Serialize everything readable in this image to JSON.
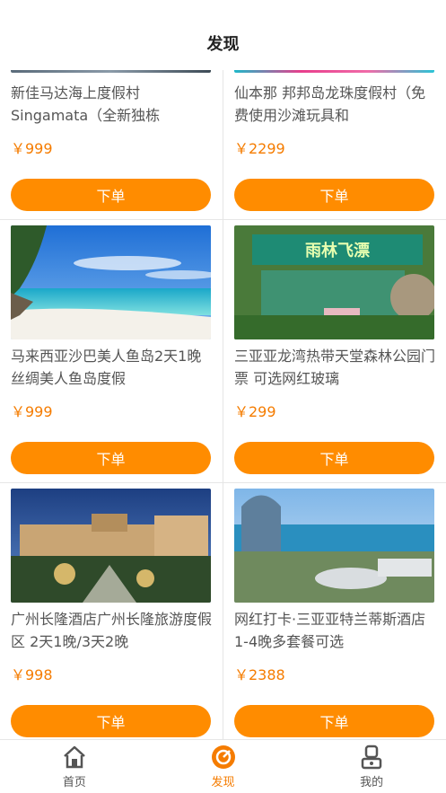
{
  "header": {
    "title": "发现"
  },
  "products": [
    {
      "name": "新佳马达海上度假村 Singamata（全新独栋",
      "price": "￥999",
      "button": "下单"
    },
    {
      "name": "仙本那 邦邦岛龙珠度假村（免费使用沙滩玩具和",
      "price": "￥2299",
      "button": "下单"
    },
    {
      "name": "马来西亚沙巴美人鱼岛2天1晚 丝绸美人鱼岛度假",
      "price": "￥999",
      "button": "下单"
    },
    {
      "name": "三亚亚龙湾热带天堂森林公园门票 可选网红玻璃",
      "price": "￥299",
      "button": "下单",
      "image_text": "雨林飞漂"
    },
    {
      "name": "广州长隆酒店广州长隆旅游度假区 2天1晚/3天2晚",
      "price": "￥998",
      "button": "下单"
    },
    {
      "name": "网红打卡·三亚亚特兰蒂斯酒店1-4晚多套餐可选",
      "price": "￥2388",
      "button": "下单"
    }
  ],
  "tabbar": {
    "items": [
      {
        "label": "首页",
        "icon": "home-icon"
      },
      {
        "label": "发现",
        "icon": "discover-icon",
        "active": true
      },
      {
        "label": "我的",
        "icon": "profile-icon"
      }
    ]
  },
  "colors": {
    "accent": "#ff8c00",
    "price": "#f57c00"
  }
}
